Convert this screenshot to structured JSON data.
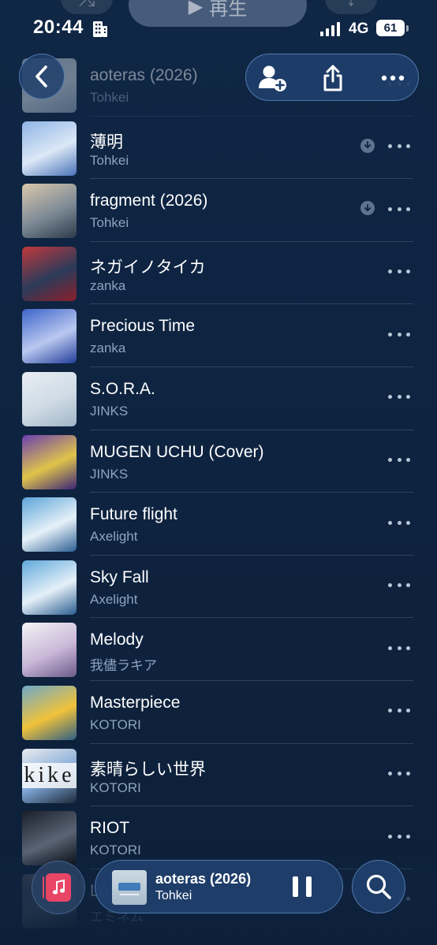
{
  "status_bar": {
    "time": "20:44",
    "network": "4G",
    "battery": "61"
  },
  "top_controls": {
    "play_label": "再生"
  },
  "header": {
    "back_icon": "chevron-left-icon",
    "actions": [
      "add-person-icon",
      "share-icon",
      "more-icon"
    ]
  },
  "songs": [
    {
      "title": "aoteras (2026)",
      "artist": "Tohkei",
      "downloaded": false,
      "art": [
        "#c7d4df",
        "#e6edf2",
        "#9db3c6"
      ]
    },
    {
      "title": "薄明",
      "artist": "Tohkei",
      "downloaded": true,
      "art": [
        "#8fb4e6",
        "#dbe8f6",
        "#4a73b8"
      ]
    },
    {
      "title": "fragment (2026)",
      "artist": "Tohkei",
      "downloaded": true,
      "art": [
        "#d9c8ad",
        "#7d8a96",
        "#2c3a4a"
      ]
    },
    {
      "title": "ネガイノタイカ",
      "artist": "zanka",
      "downloaded": false,
      "art": [
        "#c2383c",
        "#2b3b5a",
        "#8c1f2a"
      ]
    },
    {
      "title": "Precious Time",
      "artist": "zanka",
      "downloaded": false,
      "art": [
        "#3e64c9",
        "#b9c8f0",
        "#243e9a"
      ]
    },
    {
      "title": "S.O.R.A.",
      "artist": "JINKS",
      "downloaded": false,
      "art": [
        "#e8eef3",
        "#cfdbe5",
        "#9fb4c6"
      ]
    },
    {
      "title": "MUGEN UCHU (Cover)",
      "artist": "JINKS",
      "downloaded": false,
      "art": [
        "#6a3fb0",
        "#e0c44a",
        "#3a2478"
      ]
    },
    {
      "title": "Future flight",
      "artist": "Axelight",
      "downloaded": false,
      "art": [
        "#5ca4d8",
        "#e6f1f8",
        "#2c5f93"
      ]
    },
    {
      "title": "Sky Fall",
      "artist": "Axelight",
      "downloaded": false,
      "art": [
        "#5fa8db",
        "#e5f0f8",
        "#2b5d90"
      ]
    },
    {
      "title": "Melody",
      "artist": "我儘ラキア",
      "downloaded": false,
      "art": [
        "#f4f3f5",
        "#c9b8d8",
        "#6c5a8a"
      ]
    },
    {
      "title": "Masterpiece",
      "artist": "KOTORI",
      "downloaded": false,
      "art": [
        "#6fa9c9",
        "#f0c23a",
        "#2e5f84"
      ]
    },
    {
      "title": "素晴らしい世界",
      "artist": "KOTORI",
      "downloaded": false,
      "art": [
        "#e9ecef",
        "#7fa6d6",
        "#1c2a3a"
      ],
      "art_text": "kike"
    },
    {
      "title": "RIOT",
      "artist": "KOTORI",
      "downloaded": false,
      "art": [
        "#1a1f2a",
        "#5a6474",
        "#0b0e14"
      ]
    },
    {
      "title": "Lo",
      "artist": "エミネム",
      "downloaded": false,
      "art": [
        "#39424e",
        "#6f7882",
        "#222831"
      ]
    }
  ],
  "mini_player": {
    "title": "aoteras (2026)",
    "artist": "Tohkei",
    "state": "playing"
  },
  "colors": {
    "background": "#0f2340",
    "accent_border": "#78aae6",
    "library_red": "#e94565",
    "secondary_text": "#8ea3bf"
  }
}
